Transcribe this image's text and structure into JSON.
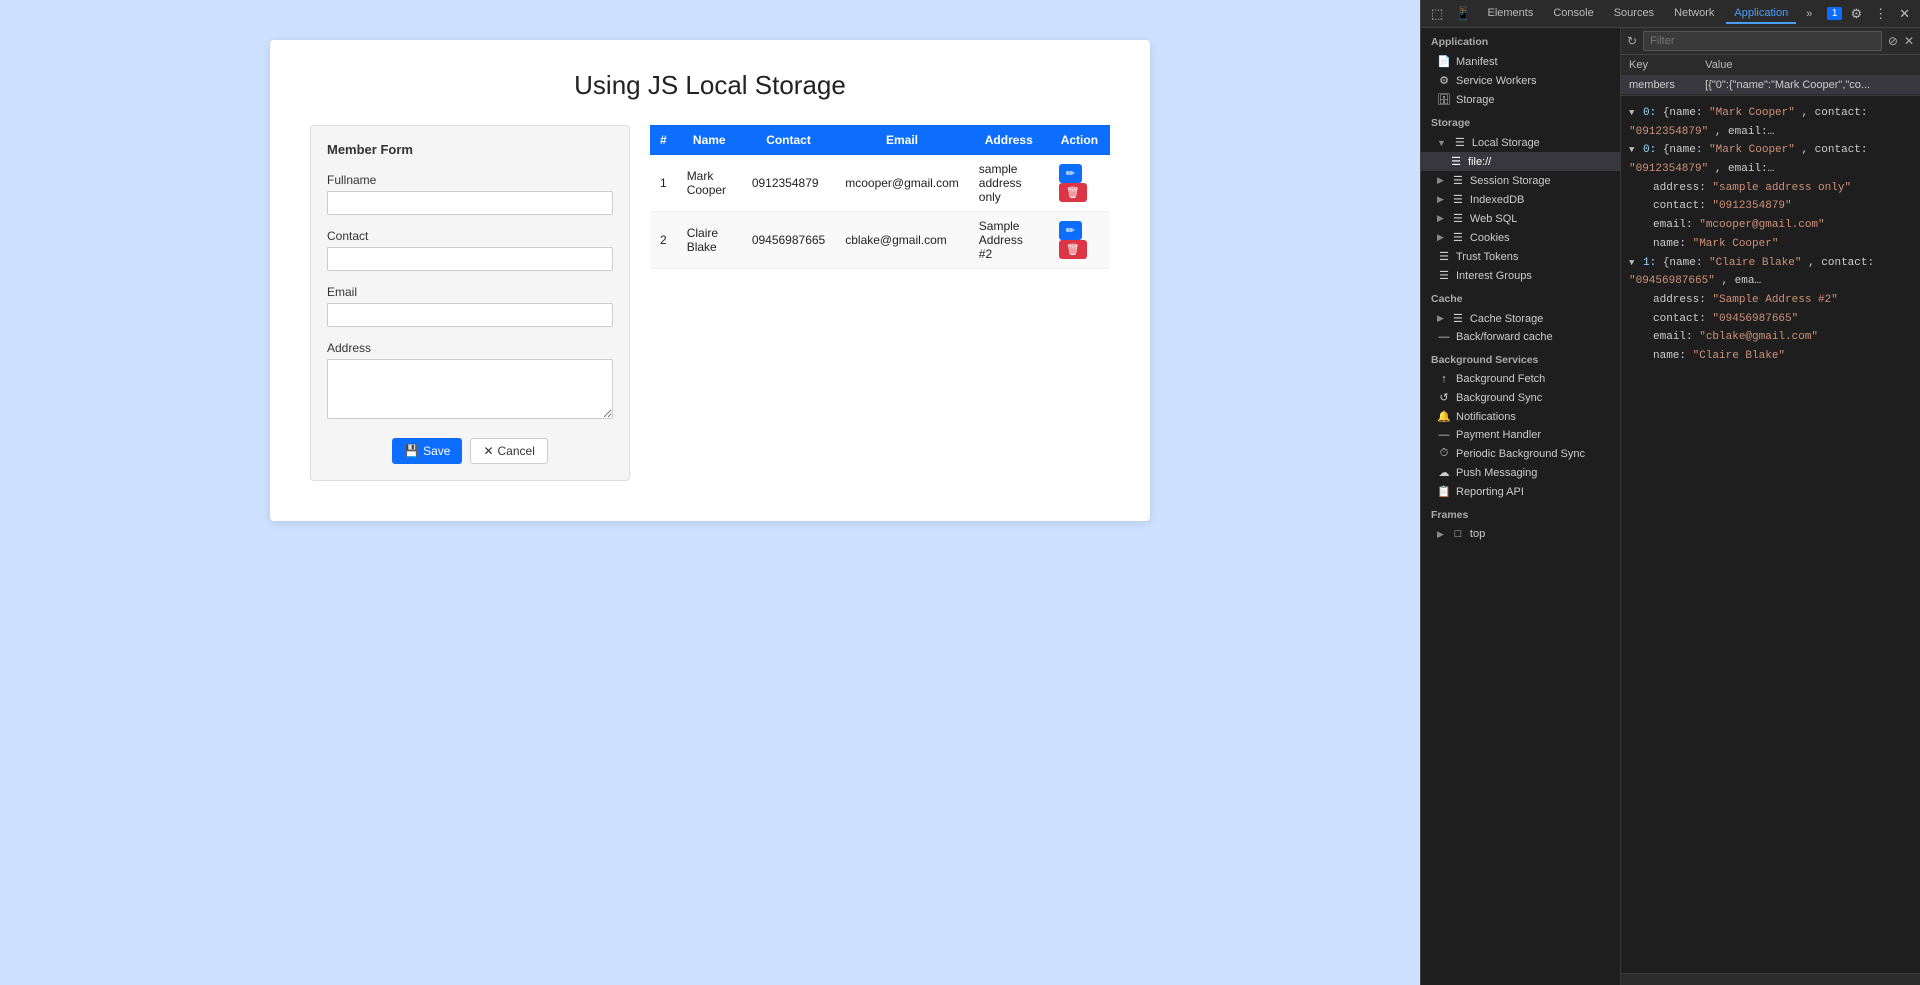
{
  "page": {
    "title": "Using JS Local Storage",
    "background_color": "#cce0ff"
  },
  "form": {
    "title": "Member Form",
    "fullname_label": "Fullname",
    "contact_label": "Contact",
    "email_label": "Email",
    "address_label": "Address",
    "save_label": "Save",
    "cancel_label": "Cancel",
    "fullname_value": "",
    "contact_value": "",
    "email_value": "",
    "address_value": ""
  },
  "table": {
    "columns": [
      "#",
      "Name",
      "Contact",
      "Email",
      "Address",
      "Action"
    ],
    "rows": [
      {
        "num": "1",
        "name": "Mark Cooper",
        "contact": "0912354879",
        "email": "mcooper@gmail.com",
        "address": "sample address only"
      },
      {
        "num": "2",
        "name": "Claire Blake",
        "contact": "09456987665",
        "email": "cblake@gmail.com",
        "address": "Sample Address #2"
      }
    ]
  },
  "devtools": {
    "tabs": [
      "Elements",
      "Console",
      "Sources",
      "Network",
      "Application"
    ],
    "active_tab": "Application",
    "toolbar_icons": [
      "inspect",
      "device"
    ],
    "filter_placeholder": "Filter",
    "sidebar": {
      "application_label": "Application",
      "items_app": [
        {
          "label": "Manifest",
          "icon": "📄",
          "indented": false
        },
        {
          "label": "Service Workers",
          "icon": "⚙",
          "indented": false
        },
        {
          "label": "Storage",
          "icon": "🗄",
          "indented": false
        }
      ],
      "storage_label": "Storage",
      "local_storage_label": "Local Storage",
      "local_storage_child": "file://",
      "session_storage_label": "Session Storage",
      "indexed_db_label": "IndexedDB",
      "web_sql_label": "Web SQL",
      "cookies_label": "Cookies",
      "trust_tokens_label": "Trust Tokens",
      "interest_groups_label": "Interest Groups",
      "cache_label": "Cache",
      "cache_storage_label": "Cache Storage",
      "back_forward_cache_label": "Back/forward cache",
      "background_services_label": "Background Services",
      "background_fetch_label": "Background Fetch",
      "background_sync_label": "Background Sync",
      "notifications_label": "Notifications",
      "payment_handler_label": "Payment Handler",
      "periodic_bg_sync_label": "Periodic Background Sync",
      "push_messaging_label": "Push Messaging",
      "reporting_api_label": "Reporting API",
      "frames_label": "Frames",
      "top_label": "top"
    },
    "kv_table": {
      "key_header": "Key",
      "value_header": "Value",
      "rows": [
        {
          "key": "members",
          "value": "[{\"0\":{\"name\":\"Mark Cooper\",\"co..."
        }
      ]
    },
    "json_preview": {
      "lines": [
        {
          "indent": 0,
          "text": "▼ 0: {name: \"Mark Cooper\", contact: \"0912354879\", email:...",
          "collapsed": false
        },
        {
          "indent": 0,
          "text": "▼ 0: {name: \"Mark Cooper\", contact: \"0912354879\", email:...",
          "collapsed": false
        },
        {
          "indent": 1,
          "label": "address:",
          "value": "\"sample address only\"",
          "color": "string"
        },
        {
          "indent": 1,
          "label": "contact:",
          "value": "\"0912354879\"",
          "color": "string"
        },
        {
          "indent": 1,
          "label": "email:",
          "value": "\"mcooper@gmail.com\"",
          "color": "string"
        },
        {
          "indent": 1,
          "label": "name:",
          "value": "\"Mark Cooper\"",
          "color": "string"
        },
        {
          "indent": 0,
          "text": "▼ 1: {name: \"Claire Blake\", contact: \"09456987665\", ema...",
          "collapsed": false
        },
        {
          "indent": 1,
          "label": "address:",
          "value": "\"Sample Address #2\"",
          "color": "string"
        },
        {
          "indent": 1,
          "label": "contact:",
          "value": "\"09456987665\"",
          "color": "string"
        },
        {
          "indent": 1,
          "label": "email:",
          "value": "\"cblake@gmail.com\"",
          "color": "string"
        },
        {
          "indent": 1,
          "label": "name:",
          "value": "\"Claire Blake\"",
          "color": "string"
        }
      ]
    }
  }
}
